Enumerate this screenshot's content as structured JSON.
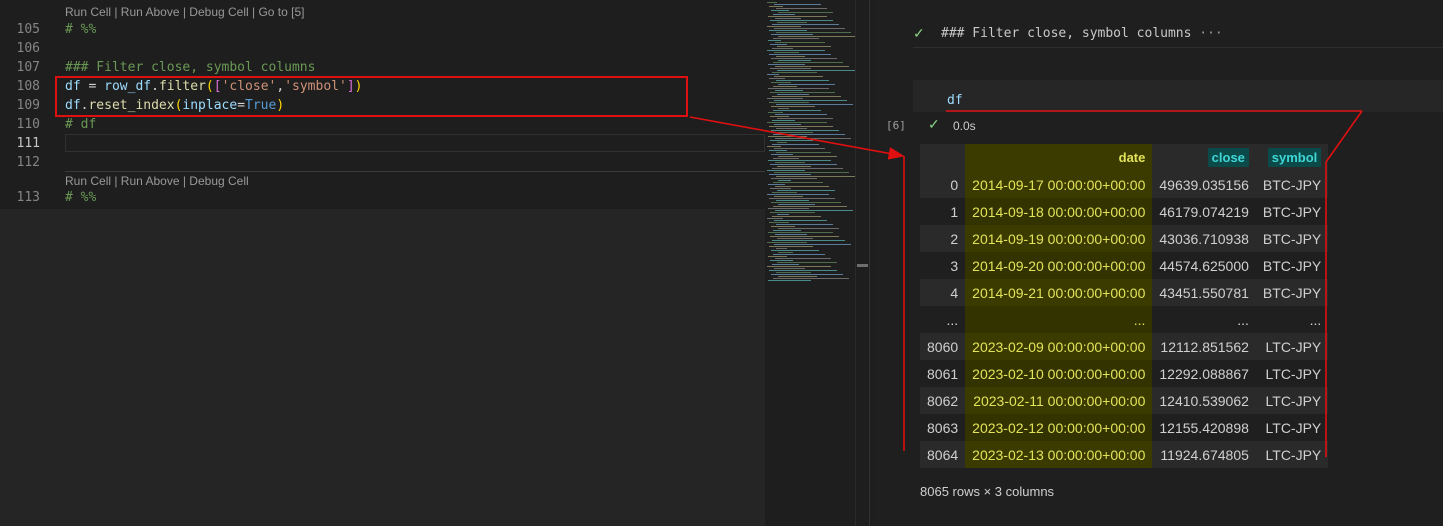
{
  "editor": {
    "codelens_top": "Run Cell | Run Above | Debug Cell | Go to [5]",
    "codelens_bottom": "Run Cell | Run Above | Debug Cell",
    "lines": [
      {
        "num": "105",
        "text": "# %%"
      },
      {
        "num": "106",
        "text": ""
      },
      {
        "num": "107",
        "text": "### Filter close, symbol columns"
      },
      {
        "num": "108",
        "text": "df = row_df.filter(['close','symbol'])"
      },
      {
        "num": "109",
        "text": "df.reset_index(inplace=True)"
      },
      {
        "num": "110",
        "text": "# df"
      },
      {
        "num": "111",
        "text": ""
      },
      {
        "num": "112",
        "text": ""
      },
      {
        "num": "113",
        "text": "# %%"
      }
    ],
    "tokens": {
      "df": "df",
      "eq": " = ",
      "row_df": "row_df",
      "dot": ".",
      "filter": "filter",
      "open_paren": "(",
      "open_br": "[",
      "close_str": "'close'",
      "comma": ",",
      "symbol_str": "'symbol'",
      "close_br": "]",
      "close_paren": ")",
      "reset_index": "reset_index",
      "inplace": "inplace",
      "assign": "=",
      "true_kw": "True"
    }
  },
  "notebook": {
    "markdown_title": "### Filter close, symbol columns",
    "markdown_ellipsis": "···",
    "cell_code": "df",
    "execution_count": "[6]",
    "exec_time": "0.0s",
    "shape": "8065 rows × 3 columns"
  },
  "table": {
    "columns": [
      "",
      "date",
      "close",
      "symbol"
    ],
    "rows": [
      [
        "0",
        "2014-09-17 00:00:00+00:00",
        "49639.035156",
        "BTC-JPY"
      ],
      [
        "1",
        "2014-09-18 00:00:00+00:00",
        "46179.074219",
        "BTC-JPY"
      ],
      [
        "2",
        "2014-09-19 00:00:00+00:00",
        "43036.710938",
        "BTC-JPY"
      ],
      [
        "3",
        "2014-09-20 00:00:00+00:00",
        "44574.625000",
        "BTC-JPY"
      ],
      [
        "4",
        "2014-09-21 00:00:00+00:00",
        "43451.550781",
        "BTC-JPY"
      ],
      [
        "...",
        "...",
        "...",
        "..."
      ],
      [
        "8060",
        "2023-02-09 00:00:00+00:00",
        "12112.851562",
        "LTC-JPY"
      ],
      [
        "8061",
        "2023-02-10 00:00:00+00:00",
        "12292.088867",
        "LTC-JPY"
      ],
      [
        "8062",
        "2023-02-11 00:00:00+00:00",
        "12410.539062",
        "LTC-JPY"
      ],
      [
        "8063",
        "2023-02-12 00:00:00+00:00",
        "12155.420898",
        "LTC-JPY"
      ],
      [
        "8064",
        "2023-02-13 00:00:00+00:00",
        "11924.674805",
        "LTC-JPY"
      ]
    ]
  },
  "colors": {
    "annotation": "#e01010",
    "date_highlight": "#3b3b00",
    "header_highlight": "#0c4a4a"
  }
}
